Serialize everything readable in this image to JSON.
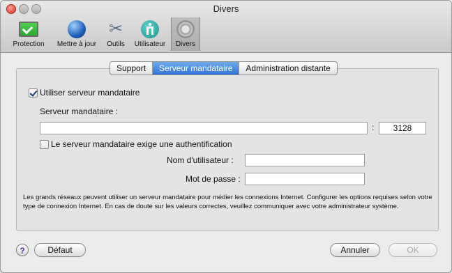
{
  "window": {
    "title": "Divers"
  },
  "toolbar": {
    "items": [
      {
        "label": "Protection",
        "icon": "protection-check-icon"
      },
      {
        "label": "Mettre à jour",
        "icon": "globe-update-icon"
      },
      {
        "label": "Outils",
        "icon": "tools-icon"
      },
      {
        "label": "Utilisateur",
        "icon": "user-icon"
      },
      {
        "label": "Divers",
        "icon": "gear-icon"
      }
    ],
    "active": "Divers"
  },
  "tabs": [
    {
      "label": "Support"
    },
    {
      "label": "Serveur mandataire"
    },
    {
      "label": "Administration distante"
    }
  ],
  "selected_tab": "Serveur mandataire",
  "proxy": {
    "use_label": "Utiliser serveur mandataire",
    "use_checked": true,
    "server_label": "Serveur mandataire :",
    "server_value": "",
    "colon": ":",
    "port_value": "3128",
    "auth_label": "Le serveur mandataire exige une authentification",
    "auth_checked": false,
    "username_label": "Nom d'utilisateur :",
    "username_value": "",
    "password_label": "Mot de passe :",
    "password_value": ""
  },
  "note": "Les grands réseaux peuvent utiliser un serveur mandataire pour médier les connexions Internet. Configurer les options requises selon votre type de connexion Internet. En cas de doute sur les valeurs correctes, veuillez communiquer avec votre administrateur système.",
  "footer": {
    "help_label": "?",
    "default_label": "Défaut",
    "cancel_label": "Annuler",
    "ok_label": "OK"
  }
}
